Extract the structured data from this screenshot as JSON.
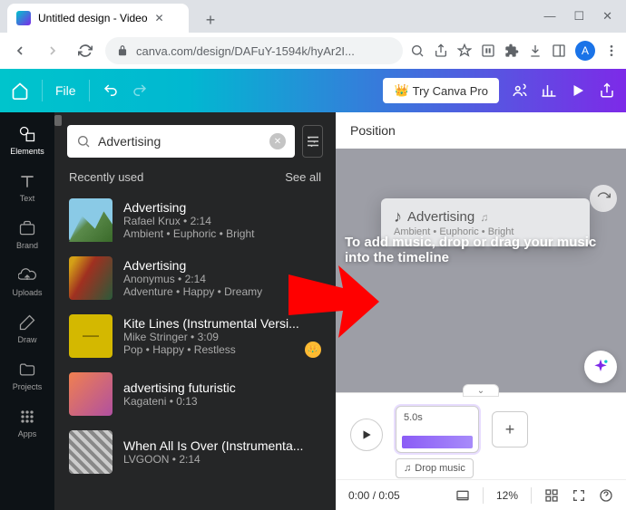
{
  "browser": {
    "tab_title": "Untitled design - Video",
    "url": "canva.com/design/DAFuY-1594k/hyAr2I...",
    "avatar_letter": "A"
  },
  "header": {
    "file": "File",
    "try_pro": "Try Canva Pro"
  },
  "rail": {
    "items": [
      {
        "label": "Elements"
      },
      {
        "label": "Text"
      },
      {
        "label": "Brand"
      },
      {
        "label": "Uploads"
      },
      {
        "label": "Draw"
      },
      {
        "label": "Projects"
      },
      {
        "label": "Apps"
      }
    ]
  },
  "search": {
    "value": "Advertising",
    "placeholder": "Search"
  },
  "section": {
    "title": "Recently used",
    "see_all": "See all"
  },
  "tracks": [
    {
      "title": "Advertising",
      "artist": "Rafael Krux",
      "dur": "2:14",
      "tags": "Ambient • Euphoric • Bright",
      "pro": false
    },
    {
      "title": "Advertising",
      "artist": "Anonymus",
      "dur": "2:14",
      "tags": "Adventure • Happy • Dreamy",
      "pro": false
    },
    {
      "title": "Kite Lines (Instrumental Versi...",
      "artist": "Mike Stringer",
      "dur": "3:09",
      "tags": "Pop • Happy • Restless",
      "pro": true
    },
    {
      "title": "advertising futuristic",
      "artist": "Kagateni",
      "dur": "0:13",
      "tags": "",
      "pro": false
    },
    {
      "title": "When All Is Over (Instrumenta...",
      "artist": "LVGOON",
      "dur": "2:14",
      "tags": "",
      "pro": false
    }
  ],
  "canvas": {
    "position_label": "Position",
    "drag_title": "Advertising",
    "drag_meta": "Ambient • Euphoric • Bright",
    "hint": "To add music, drop or drag your music into the timeline"
  },
  "timeline": {
    "clip_duration": "5.0s",
    "drop_label": "Drop music"
  },
  "status": {
    "time": "0:00 / 0:05",
    "zoom": "12%"
  }
}
